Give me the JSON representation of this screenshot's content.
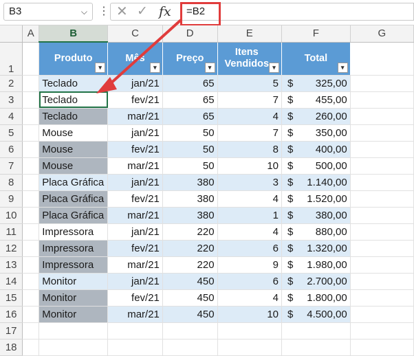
{
  "formula_bar": {
    "name_box": "B3",
    "name_box_dropdown_icon": "chevron-down-icon",
    "more_icon": "vertical-ellipsis-icon",
    "cancel_icon": "x-icon",
    "enter_icon": "check-icon",
    "function_icon": "fx",
    "formula": "=B2"
  },
  "colors": {
    "header_fill": "#5b9bd5",
    "band_fill": "#ddebf7",
    "gray_fill": "#aeb6bf",
    "callout_red": "#e03c3c",
    "selection_green": "#217346"
  },
  "column_letters": [
    "A",
    "B",
    "C",
    "D",
    "E",
    "F",
    "G"
  ],
  "selected_column": "B",
  "table": {
    "headers": [
      {
        "label": "Produto",
        "filter_icon": "filter-dropdown-icon"
      },
      {
        "label": "Mês",
        "filter_icon": "filter-dropdown-icon"
      },
      {
        "label": "Preço",
        "filter_icon": "filter-dropdown-icon"
      },
      {
        "label": "Itens Vendidos",
        "filter_icon": "filter-dropdown-icon"
      },
      {
        "label": "Total",
        "filter_icon": "filter-dropdown-icon"
      }
    ],
    "currency_symbol": "$",
    "rows": [
      {
        "row": "2",
        "produto": "Teclado",
        "mes": "jan/21",
        "preco": "65",
        "itens": "5",
        "total": "325,00",
        "gray": false
      },
      {
        "row": "3",
        "produto": "Teclado",
        "mes": "fev/21",
        "preco": "65",
        "itens": "7",
        "total": "455,00",
        "gray": false
      },
      {
        "row": "4",
        "produto": "Teclado",
        "mes": "mar/21",
        "preco": "65",
        "itens": "4",
        "total": "260,00",
        "gray": true
      },
      {
        "row": "5",
        "produto": "Mouse",
        "mes": "jan/21",
        "preco": "50",
        "itens": "7",
        "total": "350,00",
        "gray": false
      },
      {
        "row": "6",
        "produto": "Mouse",
        "mes": "fev/21",
        "preco": "50",
        "itens": "8",
        "total": "400,00",
        "gray": true
      },
      {
        "row": "7",
        "produto": "Mouse",
        "mes": "mar/21",
        "preco": "50",
        "itens": "10",
        "total": "500,00",
        "gray": true
      },
      {
        "row": "8",
        "produto": "Placa Gráfica",
        "mes": "jan/21",
        "preco": "380",
        "itens": "3",
        "total": "1.140,00",
        "gray": false
      },
      {
        "row": "9",
        "produto": "Placa Gráfica",
        "mes": "fev/21",
        "preco": "380",
        "itens": "4",
        "total": "1.520,00",
        "gray": true
      },
      {
        "row": "10",
        "produto": "Placa Gráfica",
        "mes": "mar/21",
        "preco": "380",
        "itens": "1",
        "total": "380,00",
        "gray": true
      },
      {
        "row": "11",
        "produto": "Impressora",
        "mes": "jan/21",
        "preco": "220",
        "itens": "4",
        "total": "880,00",
        "gray": false
      },
      {
        "row": "12",
        "produto": "Impressora",
        "mes": "fev/21",
        "preco": "220",
        "itens": "6",
        "total": "1.320,00",
        "gray": true
      },
      {
        "row": "13",
        "produto": "Impressora",
        "mes": "mar/21",
        "preco": "220",
        "itens": "9",
        "total": "1.980,00",
        "gray": true
      },
      {
        "row": "14",
        "produto": "Monitor",
        "mes": "jan/21",
        "preco": "450",
        "itens": "6",
        "total": "2.700,00",
        "gray": false
      },
      {
        "row": "15",
        "produto": "Monitor",
        "mes": "fev/21",
        "preco": "450",
        "itens": "4",
        "total": "1.800,00",
        "gray": true
      },
      {
        "row": "16",
        "produto": "Monitor",
        "mes": "mar/21",
        "preco": "450",
        "itens": "10",
        "total": "4.500,00",
        "gray": true
      }
    ]
  },
  "empty_rows": [
    "17",
    "18"
  ],
  "header_row_number": "1",
  "active_cell": "B3",
  "arrow_icon": "red-arrow-icon"
}
